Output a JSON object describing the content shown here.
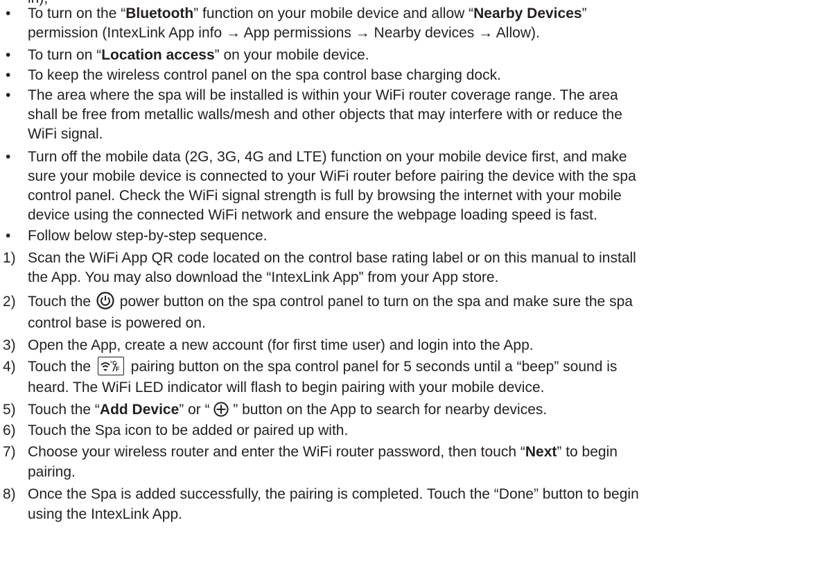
{
  "top_fragment": "in),",
  "bullets": [
    {
      "parts": [
        "To turn on the “",
        "Bluetooth",
        "” function on your mobile device and allow “",
        "Nearby Devices",
        "”"
      ]
    },
    {
      "line2": "permission (IntexLink App info → App permissions → Nearby devices → Allow)."
    },
    {
      "parts": [
        "To turn on “",
        "Location access",
        "” on your mobile device."
      ]
    },
    {
      "text": "To keep the wireless control panel on the spa control base charging dock."
    },
    {
      "lines": [
        "The area where the spa will be installed is within your WiFi router coverage range. The area",
        "shall be free from metallic walls/mesh and other objects that may interfere with or reduce the",
        "WiFi signal."
      ]
    },
    {
      "lines": [
        "Turn off the mobile data (2G, 3G, 4G and LTE) function on your mobile device first, and make",
        "sure your mobile device is connected to your WiFi router before pairing the device with the spa",
        "control panel. Check the WiFi signal strength is full by browsing the internet with your mobile",
        "device using the connected WiFi network and ensure the webpage loading speed is fast."
      ]
    },
    {
      "text": "Follow below step-by-step sequence."
    }
  ],
  "bullet_char": "•",
  "steps": [
    {
      "num": "1)",
      "lines": [
        "Scan the WiFi App QR code located on the control base rating label or on this manual to install",
        "the App. You may also download the “IntexLink App” from your App store."
      ]
    },
    {
      "num": "2)",
      "a": "Touch the",
      "b": "power button on the spa control panel to turn on the spa and make sure the spa",
      "line2": "control base is powered on."
    },
    {
      "num": "3)",
      "text": "Open the App, create a new account (for first time user) and login into the App."
    },
    {
      "num": "4)",
      "a": "Touch the",
      "b": "pairing button on the spa control panel for 5 seconds until a “beep” sound is",
      "line2": "heard. The WiFi LED indicator will flash to begin pairing with your mobile device."
    },
    {
      "num": "5)",
      "parts": [
        "Touch the “",
        "Add Device",
        "” or “ ",
        " ” button on the App to search for nearby devices."
      ]
    },
    {
      "num": "6)",
      "text": "Touch the Spa icon to be added or paired up with."
    },
    {
      "num": "7)",
      "parts": [
        "Choose your wireless router and enter the WiFi router password, then touch “",
        "Next",
        "” to begin"
      ],
      "line2": "pairing."
    },
    {
      "num": "8)",
      "lines": [
        "Once the Spa is added successfully, the pairing is completed. Touch the “Done” button to begin",
        "using the IntexLink App."
      ]
    }
  ],
  "icons": {
    "power": "power-icon",
    "pairing": "wifi-pairing-icon",
    "add": "circle-plus-icon"
  },
  "pair_icon_text": "°C/°F"
}
